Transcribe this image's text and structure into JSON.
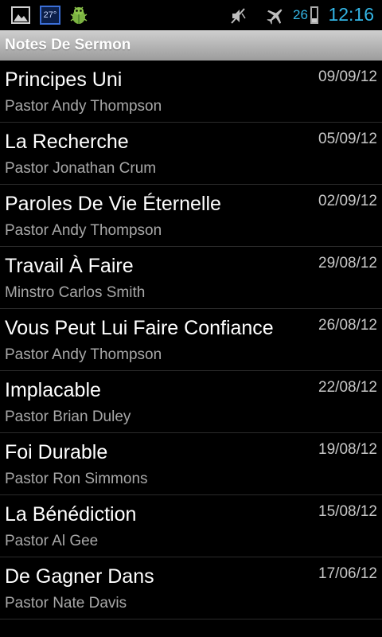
{
  "status_bar": {
    "weather_temp": "27°",
    "battery_level": "26",
    "battery_fraction": 0.26,
    "time": "12:16",
    "icons": [
      "picture-icon",
      "weather-icon",
      "android-bug-icon",
      "mute-icon",
      "airplane-mode-icon",
      "battery-icon"
    ]
  },
  "header": {
    "title": "Notes De Sermon"
  },
  "sermons": [
    {
      "title": "Principes Uni",
      "pastor": "Pastor Andy Thompson",
      "date": "09/09/12"
    },
    {
      "title": "La Recherche",
      "pastor": "Pastor Jonathan Crum",
      "date": "05/09/12"
    },
    {
      "title": "Paroles De Vie Éternelle",
      "pastor": "Pastor Andy Thompson",
      "date": "02/09/12"
    },
    {
      "title": "Travail À Faire",
      "pastor": "Minstro Carlos Smith",
      "date": "29/08/12"
    },
    {
      "title": "Vous Peut Lui Faire Confiance",
      "pastor": "Pastor Andy Thompson",
      "date": "26/08/12"
    },
    {
      "title": "Implacable",
      "pastor": "Pastor Brian Duley",
      "date": "22/08/12"
    },
    {
      "title": "Foi Durable",
      "pastor": "Pastor Ron Simmons",
      "date": "19/08/12"
    },
    {
      "title": "La Bénédiction",
      "pastor": "Pastor Al Gee",
      "date": "15/08/12"
    },
    {
      "title": "De Gagner Dans",
      "pastor": "Pastor Nate Davis",
      "date": "17/06/12"
    }
  ],
  "colors": {
    "accent": "#33b5e5",
    "background": "#000000",
    "header_bar": "#b5b5b5"
  }
}
